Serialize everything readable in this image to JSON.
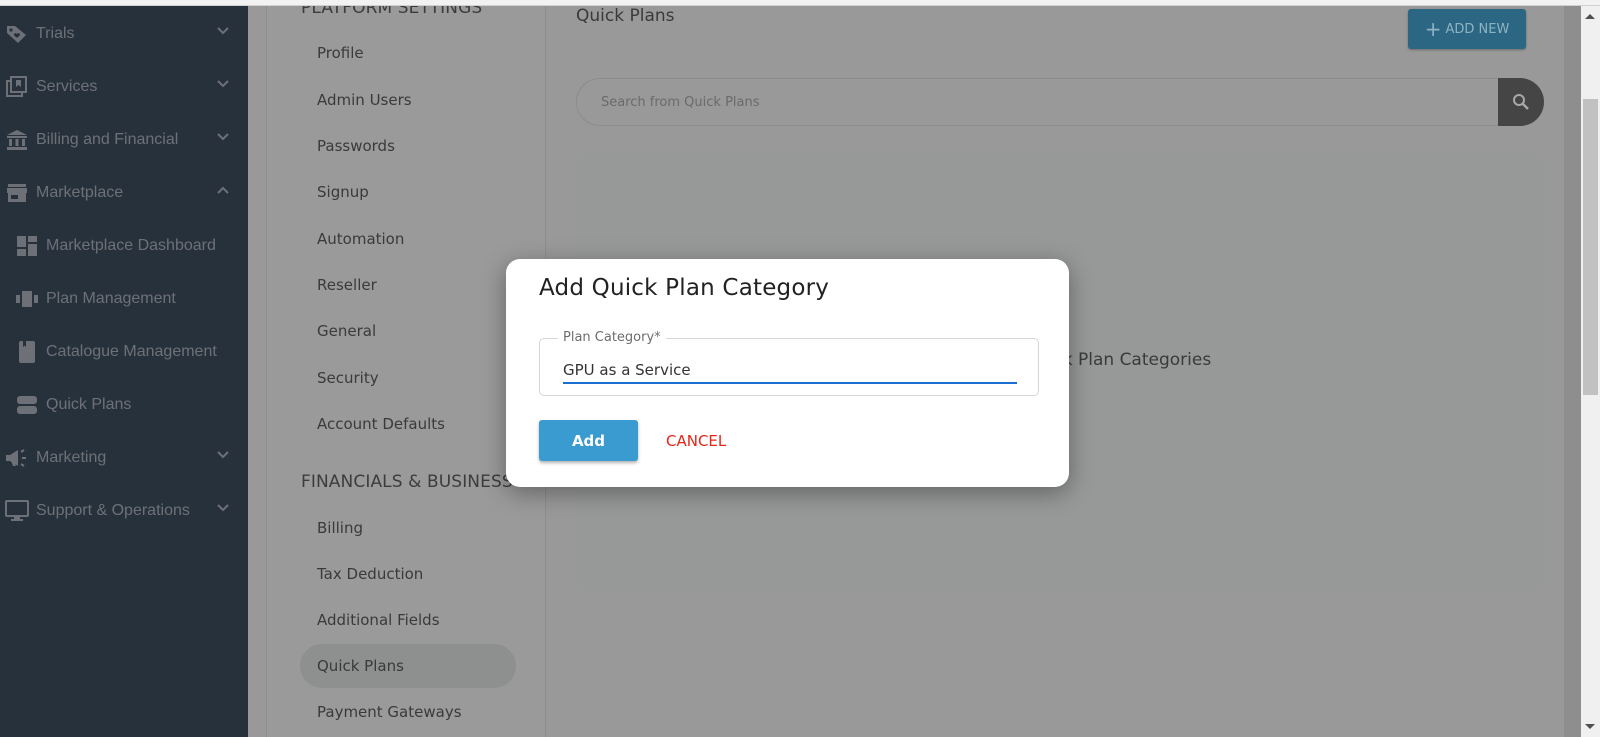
{
  "left_nav": {
    "items": [
      {
        "label": "Trials",
        "icon": "tag-heart-icon",
        "chevron": "down"
      },
      {
        "label": "Services",
        "icon": "services-icon",
        "chevron": "down"
      },
      {
        "label": "Billing and Financial",
        "icon": "bank-icon",
        "chevron": "down"
      },
      {
        "label": "Marketplace",
        "icon": "store-icon",
        "chevron": "up"
      },
      {
        "label": "Marketplace Dashboard",
        "icon": "dashboard-icon",
        "sub": true
      },
      {
        "label": "Plan Management",
        "icon": "plan-management-icon",
        "sub": true
      },
      {
        "label": "Catalogue Management",
        "icon": "book-icon",
        "sub": true
      },
      {
        "label": "Quick Plans",
        "icon": "quick-plans-icon",
        "sub": true
      },
      {
        "label": "Marketing",
        "icon": "megaphone-icon",
        "chevron": "down"
      },
      {
        "label": "Support & Operations",
        "icon": "monitor-icon",
        "chevron": "down"
      }
    ]
  },
  "settings_nav": {
    "sections": [
      {
        "title": "PLATFORM SETTINGS",
        "items": [
          "Profile",
          "Admin Users",
          "Passwords",
          "Signup",
          "Automation",
          "Reseller",
          "General",
          "Security",
          "Account Defaults"
        ]
      },
      {
        "title": "FINANCIALS & BUSINESS",
        "items": [
          "Billing",
          "Tax Deduction",
          "Additional Fields",
          "Quick Plans",
          "Payment Gateways"
        ]
      }
    ],
    "active_item": "Quick Plans"
  },
  "main": {
    "title": "Quick Plans",
    "add_new_label": "ADD NEW",
    "search_placeholder": "Search from Quick Plans",
    "empty_text": "No Quick Plan Categories"
  },
  "modal": {
    "title": "Add Quick Plan Category",
    "field_label": "Plan Category*",
    "field_value": "GPU as a Service",
    "add_label": "Add",
    "cancel_label": "CANCEL"
  },
  "colors": {
    "sidebar_bg": "#27313c",
    "add_button": "#3a9bd0",
    "cancel_text": "#e4261a",
    "input_focus_underline": "#1a6fd0"
  }
}
